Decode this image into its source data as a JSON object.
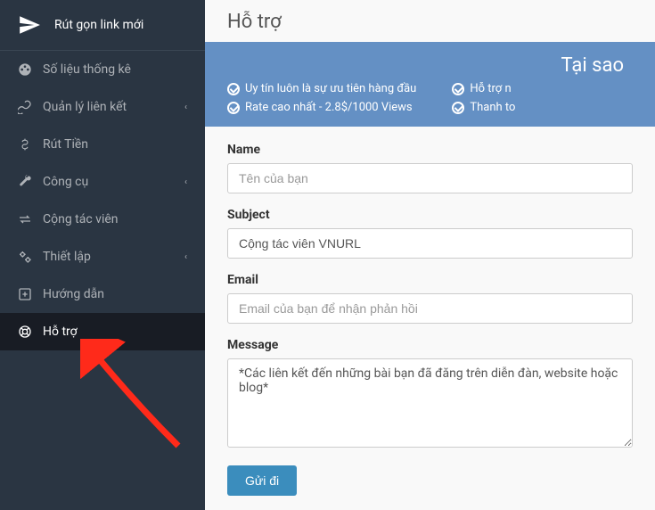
{
  "brand": {
    "text": "Rút gọn link mới"
  },
  "sidebar": {
    "items": [
      {
        "label": "Số liệu thống kê",
        "icon": "dashboard-icon",
        "has_submenu": false
      },
      {
        "label": "Quản lý liên kết",
        "icon": "link-icon",
        "has_submenu": true
      },
      {
        "label": "Rút Tiền",
        "icon": "dollar-icon",
        "has_submenu": false
      },
      {
        "label": "Công cụ",
        "icon": "wrench-icon",
        "has_submenu": true
      },
      {
        "label": "Cộng tác viên",
        "icon": "exchange-icon",
        "has_submenu": false
      },
      {
        "label": "Thiết lập",
        "icon": "gears-icon",
        "has_submenu": true
      },
      {
        "label": "Hướng dẫn",
        "icon": "plus-square-icon",
        "has_submenu": false
      },
      {
        "label": "Hỗ trợ",
        "icon": "life-ring-icon",
        "has_submenu": false
      }
    ]
  },
  "page": {
    "title": "Hỗ trợ"
  },
  "banner": {
    "title": "Tại sao",
    "col1": [
      "Uy tín luôn là sự ưu tiên hàng đầu",
      "Rate cao nhất - 2.8$/1000 Views"
    ],
    "col2": [
      "Hỗ trợ n",
      "Thanh to"
    ]
  },
  "form": {
    "name_label": "Name",
    "name_placeholder": "Tên của bạn",
    "subject_label": "Subject",
    "subject_value": "Cộng tác viên VNURL",
    "email_label": "Email",
    "email_placeholder": "Email của bạn để nhận phản hồi",
    "message_label": "Message",
    "message_value": "*Các liên kết đến những bài bạn đã đăng trên diễn đàn, website hoặc blog*",
    "submit_label": "Gửi đi"
  },
  "chevron": "‹"
}
